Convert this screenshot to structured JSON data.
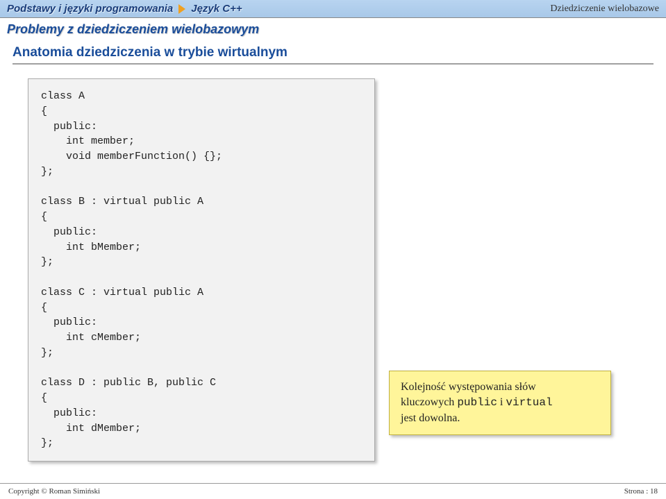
{
  "header": {
    "breadcrumb1": "Podstawy i języki programowania",
    "breadcrumb2": "Język C++",
    "right": "Dziedziczenie wielobazowe"
  },
  "subtitle": "Problemy z dziedziczeniem wielobazowym",
  "section_title": "Anatomia dziedziczenia w trybie wirtualnym",
  "code": "class A\n{\n  public:\n    int member;\n    void memberFunction() {};\n};\n\nclass B : virtual public A\n{\n  public:\n    int bMember;\n};\n\nclass C : virtual public A\n{\n  public:\n    int cMember;\n};\n\nclass D : public B, public C\n{\n  public:\n    int dMember;\n};",
  "note": {
    "line1": "Kolejność występowania słów",
    "line2a": "kluczowych ",
    "kw1": "public",
    "mid": " i ",
    "kw2": "virtual",
    "line3": "jest dowolna."
  },
  "footer": {
    "left": "Copyright © Roman Simiński",
    "right": "Strona : 18"
  }
}
